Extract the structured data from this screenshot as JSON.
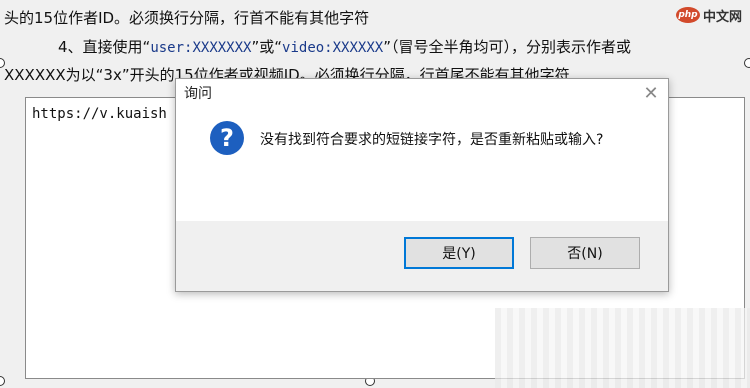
{
  "background": {
    "line1": "头的15位作者ID。必须换行分隔，行首不能有其他字符",
    "line2_prefix": "4、直接使用“",
    "line2_user": "user:XXXXXXX",
    "line2_mid": "”或“",
    "line2_video": "video:XXXXXX",
    "line2_suffix": "”（冒号全半角均可），分别表示作者或",
    "line3": "XXXXXX为以“3x”开头的15位作者或视频ID。必须换行分隔，行首尾不能有其他字符",
    "textarea_value": "https://v.kuaish"
  },
  "watermark": {
    "logo": "php",
    "text": "中文网"
  },
  "dialog": {
    "title": "询问",
    "close_glyph": "✕",
    "icon": "question-icon",
    "icon_glyph": "?",
    "message": "没有找到符合要求的短链接字符，是否重新粘贴或输入?",
    "yes_label": "是(Y)",
    "no_label": "否(N)"
  },
  "colors": {
    "icon_blue": "#1d5fbf",
    "focus_border": "#0078d7"
  }
}
